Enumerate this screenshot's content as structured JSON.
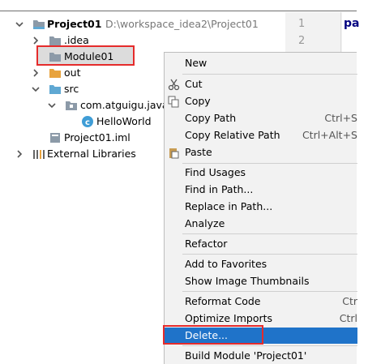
{
  "tree": {
    "project": {
      "name": "Project01",
      "path": "D:\\workspace_idea2\\Project01"
    },
    "items": [
      {
        "label": ".idea"
      },
      {
        "label": "Module01"
      },
      {
        "label": "out"
      },
      {
        "label": "src"
      },
      {
        "label": "com.atguigu.java"
      },
      {
        "label": "HelloWorld"
      },
      {
        "label": "Project01.iml"
      },
      {
        "label": "External Libraries"
      }
    ]
  },
  "editor": {
    "line_numbers": [
      "1",
      "2"
    ],
    "code_fragment": "pa"
  },
  "menu": {
    "items": [
      {
        "label": "New",
        "shortcut": ""
      },
      {
        "label": "Cut",
        "shortcut": ""
      },
      {
        "label": "Copy",
        "shortcut": ""
      },
      {
        "label": "Copy Path",
        "shortcut": "Ctrl+S"
      },
      {
        "label": "Copy Relative Path",
        "shortcut": "Ctrl+Alt+S"
      },
      {
        "label": "Paste",
        "shortcut": ""
      },
      {
        "label": "Find Usages",
        "shortcut": ""
      },
      {
        "label": "Find in Path...",
        "shortcut": ""
      },
      {
        "label": "Replace in Path...",
        "shortcut": ""
      },
      {
        "label": "Analyze",
        "shortcut": ""
      },
      {
        "label": "Refactor",
        "shortcut": ""
      },
      {
        "label": "Add to Favorites",
        "shortcut": ""
      },
      {
        "label": "Show Image Thumbnails",
        "shortcut": ""
      },
      {
        "label": "Reformat Code",
        "shortcut": "Ctr"
      },
      {
        "label": "Optimize Imports",
        "shortcut": "Ctrl"
      },
      {
        "label": "Delete...",
        "shortcut": ""
      },
      {
        "label": "Build Module 'Project01'",
        "shortcut": ""
      }
    ]
  },
  "colors": {
    "selection": "#1f73c9",
    "highlight_border": "#e52b2b",
    "folder": "#8c9aa8",
    "src_folder": "#5fa8d3"
  }
}
